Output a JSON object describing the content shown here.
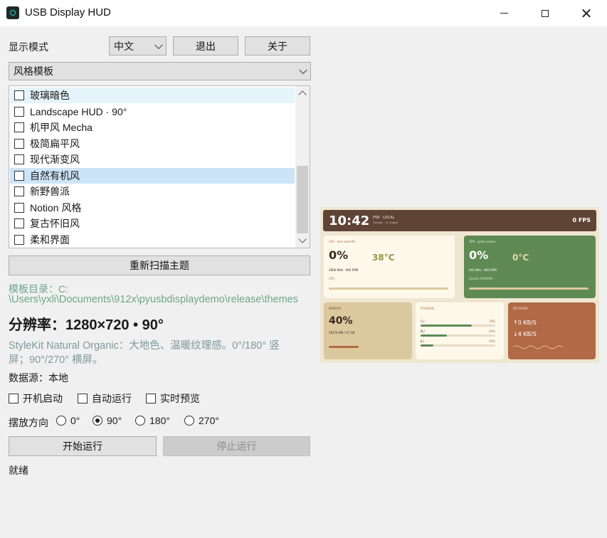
{
  "window": {
    "title": "USB Display HUD"
  },
  "top_row": {
    "display_mode_label": "显示模式",
    "language_value": "中文",
    "exit_label": "退出",
    "about_label": "关于"
  },
  "template_select": {
    "value": "风格模板"
  },
  "theme_list": {
    "items": [
      {
        "label": "玻璃暗色",
        "checked": false
      },
      {
        "label": "Landscape HUD · 90°",
        "checked": false
      },
      {
        "label": "机甲风 Mecha",
        "checked": false
      },
      {
        "label": "极简扁平风",
        "checked": false
      },
      {
        "label": "现代渐变风",
        "checked": false
      },
      {
        "label": "自然有机风",
        "checked": false,
        "selected": true
      },
      {
        "label": "新野兽派",
        "checked": false
      },
      {
        "label": "Notion 风格",
        "checked": false
      },
      {
        "label": "复古怀旧风",
        "checked": false
      },
      {
        "label": "柔和界面",
        "checked": false
      }
    ]
  },
  "rescan_label": "重新扫描主题",
  "template_dir": {
    "line1": "模板目录：C:",
    "line2": "\\Users\\yxli\\Documents\\912x\\pyusbdisplaydemo\\release\\themes"
  },
  "resolution_text": "分辨率：1280×720 • 90°",
  "description": {
    "line1": "StyleKit Natural Organic：大地色、温暖纹理感。0°/180° 竖",
    "line2": "屏；90°/270° 横屏。"
  },
  "data_source": "数据源：本地",
  "options": {
    "autostart": "开机启动",
    "autorun": "自动运行",
    "live_preview": "实时预览"
  },
  "orientation": {
    "label": "摆放方向",
    "options": [
      "0°",
      "90°",
      "180°",
      "270°"
    ],
    "selected": "90°"
  },
  "start_label": "开始运行",
  "stop_label": "停止运行",
  "status": "就绪",
  "preview": {
    "time": "10:42",
    "location": "PSE · LOCAL",
    "date": "Tuesday · 11 August",
    "fps": "0 FPS",
    "cpu": {
      "title": "CPU · zero warmth",
      "percent": "0%",
      "temp": "38°C",
      "freq": "2800 MHz · 900 RPM",
      "tag": "CPU",
      "bar_fraction": 0.0
    },
    "gpu": {
      "title": "GPU · green power",
      "percent": "0%",
      "temp": "0°C",
      "freq": "405 MHz · 800 RPM",
      "tag": "Quadro M2000M"
    },
    "memory": {
      "title": "MEMORY",
      "percent": "40%",
      "detail": "19178 MB / 47 GB",
      "bar_fraction": 0.4
    },
    "storage": {
      "title": "STORAGE",
      "drives": [
        {
          "name": "C:/",
          "percent": "78%",
          "fraction": 0.78
        },
        {
          "name": "D:/",
          "percent": "40%",
          "fraction": 0.4
        },
        {
          "name": "E:/",
          "percent": "20%",
          "fraction": 0.2
        }
      ]
    },
    "network": {
      "title": "NETWORK",
      "up": "↑0 KB/S",
      "down": "↓4 KB/S"
    },
    "colors": {
      "header": "#5f4436",
      "cpu_card": "#fdf8ea",
      "gpu_card": "#5f8a53",
      "memory_card": "#dcc89d",
      "network_card": "#b16a45",
      "accent_green": "#5f8a53",
      "accent_brown": "#b16a45"
    }
  }
}
